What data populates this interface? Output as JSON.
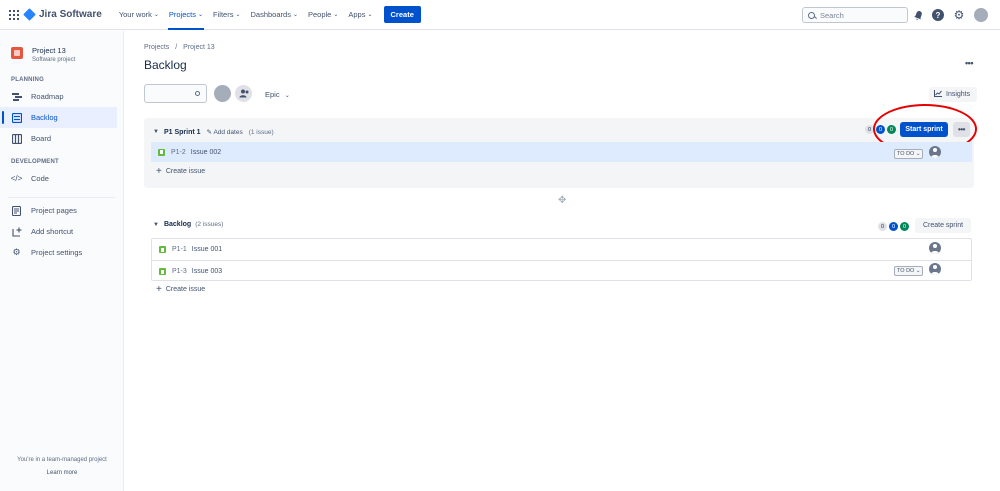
{
  "nav": {
    "logo": "Jira Software",
    "items": [
      "Your work",
      "Projects",
      "Filters",
      "Dashboards",
      "People",
      "Apps"
    ],
    "create": "Create",
    "search_placeholder": "Search"
  },
  "sidebar": {
    "project_name": "Project 13",
    "project_type": "Software project",
    "planning_label": "PLANNING",
    "planning": [
      "Roadmap",
      "Backlog",
      "Board"
    ],
    "development_label": "DEVELOPMENT",
    "development": [
      "Code"
    ],
    "other": [
      "Project pages",
      "Add shortcut",
      "Project settings"
    ],
    "footer": "You're in a team-managed project",
    "learn_more": "Learn more"
  },
  "main": {
    "breadcrumbs": [
      "Projects",
      "/",
      "Project 13"
    ],
    "title": "Backlog",
    "epic": "Epic",
    "insights": "Insights"
  },
  "sprint": {
    "name": "P1 Sprint 1",
    "add_dates": "Add dates",
    "count": "(1 issue)",
    "badges": [
      "0",
      "0",
      "0"
    ],
    "start": "Start sprint",
    "issues": [
      {
        "key": "P1-2",
        "summary": "Issue 002",
        "status": "TO DO"
      }
    ],
    "create_issue": "Create issue"
  },
  "backlog": {
    "name": "Backlog",
    "count": "(2 issues)",
    "badges": [
      "0",
      "0",
      "0"
    ],
    "create_sprint": "Create sprint",
    "issues": [
      {
        "key": "P1-1",
        "summary": "Issue 001",
        "status": ""
      },
      {
        "key": "P1-3",
        "summary": "Issue 003",
        "status": "TO DO"
      }
    ],
    "create_issue": "Create issue"
  },
  "colors": {
    "primary": "#0052cc",
    "highlight_ring": "#e60000",
    "story": "#63ba3c",
    "done_badge": "#00875a"
  }
}
